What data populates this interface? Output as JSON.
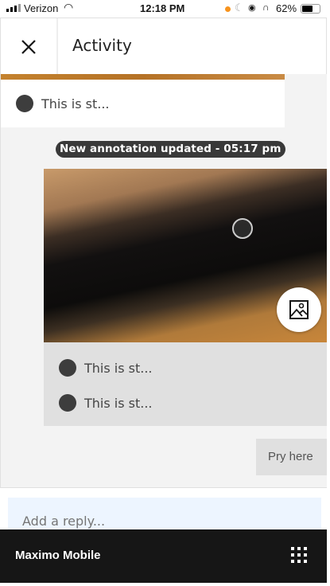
{
  "status_bar": {
    "carrier": "Verizon",
    "time": "12:18 PM",
    "battery": "62%"
  },
  "header": {
    "title": "Activity",
    "close_icon": "close-icon"
  },
  "feed": {
    "top_card": {
      "item": "This is st..."
    },
    "timestamp": "New annotation updated - 05:17 pm",
    "annotation_card": {
      "items": [
        "This is st...",
        "This is st..."
      ],
      "image_button_icon": "image-icon"
    },
    "reply_bubble": "Pry here"
  },
  "reply_input": {
    "placeholder": "Add a reply..."
  },
  "bottom_bar": {
    "app_name": "Maximo Mobile",
    "menu_icon": "app-switcher-grid-icon"
  }
}
